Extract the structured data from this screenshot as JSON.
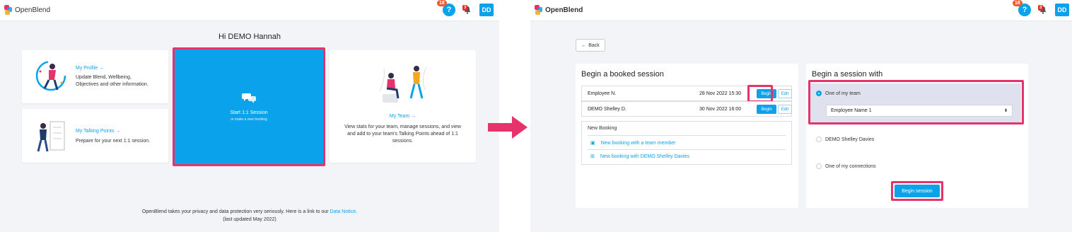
{
  "brand": {
    "name": "OpenBlend"
  },
  "top": {
    "help_badge": "18",
    "bell_badge": "3",
    "avatar": "DD"
  },
  "home": {
    "greeting": "Hi DEMO Hannah",
    "my_profile": {
      "title": "My Profile →",
      "desc_lines": [
        "Update Blend, Wellbeing,",
        "Objectives and other information."
      ]
    },
    "talking_points": {
      "title": "My Talking Points →",
      "desc": "Prepare for your next 1:1 session."
    },
    "start_session": {
      "title": "Start 1:1 Session",
      "sub": "or make a new booking"
    },
    "my_team": {
      "title": "My Team →",
      "desc_lines": [
        "View stats for your team, manage sessions, and view",
        "and add to your team's Talking Points ahead of 1:1",
        "sessions."
      ]
    },
    "footer_line1": "OpenBlend takes your privacy and data protection very seriously. Here is a link to our",
    "footer_link": "Data Notice",
    "footer_line1_end": ".",
    "footer_line2": "(last updated May 2022)"
  },
  "session": {
    "back_label": "Back",
    "booked_title": "Begin a booked session",
    "bookings": [
      {
        "name": "Employee N.",
        "datetime": "28 Nov 2022 15:30",
        "begin": "Begin",
        "edit": "Edit"
      },
      {
        "name": "DEMO Shelley D.",
        "datetime": "30 Nov 2022 16:00",
        "begin": "Begin",
        "edit": "Edit"
      }
    ],
    "new_booking": {
      "header": "New Booking",
      "links": [
        "New booking with a team member",
        "New booking with DEMO Shelley Davies"
      ]
    },
    "with_title": "Begin a session with",
    "options": [
      "One of my team",
      "DEMO Shelley Davies",
      "One of my connections"
    ],
    "select_value": "Employee Name 1",
    "begin_session_label": "Begin session"
  },
  "colors": {
    "accent": "#0aa2ea",
    "highlight": "#e6336c",
    "badge_orange": "#f05a28",
    "badge_red": "#e02d2d"
  }
}
